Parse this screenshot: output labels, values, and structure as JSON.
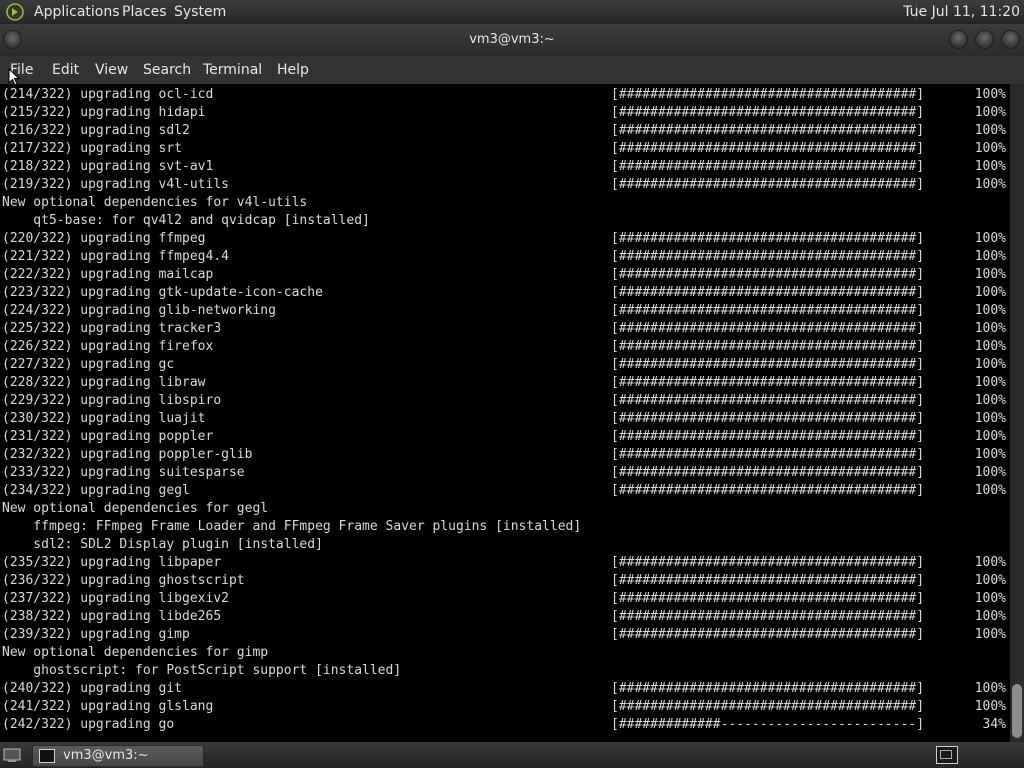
{
  "top_panel": {
    "menus": [
      "Applications",
      "Places",
      "System"
    ],
    "clock": "Tue Jul 11, 11:20"
  },
  "window": {
    "title": "vm3@vm3:~"
  },
  "menubar": {
    "items": [
      "File",
      "Edit",
      "View",
      "Search",
      "Terminal",
      "Help"
    ]
  },
  "terminal": {
    "lines": [
      {
        "text": "(214/322) upgrading ocl-icd",
        "bar": "[######################################]",
        "pct": "100%"
      },
      {
        "text": "(215/322) upgrading hidapi",
        "bar": "[######################################]",
        "pct": "100%"
      },
      {
        "text": "(216/322) upgrading sdl2",
        "bar": "[######################################]",
        "pct": "100%"
      },
      {
        "text": "(217/322) upgrading srt",
        "bar": "[######################################]",
        "pct": "100%"
      },
      {
        "text": "(218/322) upgrading svt-av1",
        "bar": "[######################################]",
        "pct": "100%"
      },
      {
        "text": "(219/322) upgrading v4l-utils",
        "bar": "[######################################]",
        "pct": "100%"
      },
      {
        "text": "New optional dependencies for v4l-utils"
      },
      {
        "text": "    qt5-base: for qv4l2 and qvidcap [installed]"
      },
      {
        "text": "(220/322) upgrading ffmpeg",
        "bar": "[######################################]",
        "pct": "100%"
      },
      {
        "text": "(221/322) upgrading ffmpeg4.4",
        "bar": "[######################################]",
        "pct": "100%"
      },
      {
        "text": "(222/322) upgrading mailcap",
        "bar": "[######################################]",
        "pct": "100%"
      },
      {
        "text": "(223/322) upgrading gtk-update-icon-cache",
        "bar": "[######################################]",
        "pct": "100%"
      },
      {
        "text": "(224/322) upgrading glib-networking",
        "bar": "[######################################]",
        "pct": "100%"
      },
      {
        "text": "(225/322) upgrading tracker3",
        "bar": "[######################################]",
        "pct": "100%"
      },
      {
        "text": "(226/322) upgrading firefox",
        "bar": "[######################################]",
        "pct": "100%"
      },
      {
        "text": "(227/322) upgrading gc",
        "bar": "[######################################]",
        "pct": "100%"
      },
      {
        "text": "(228/322) upgrading libraw",
        "bar": "[######################################]",
        "pct": "100%"
      },
      {
        "text": "(229/322) upgrading libspiro",
        "bar": "[######################################]",
        "pct": "100%"
      },
      {
        "text": "(230/322) upgrading luajit",
        "bar": "[######################################]",
        "pct": "100%"
      },
      {
        "text": "(231/322) upgrading poppler",
        "bar": "[######################################]",
        "pct": "100%"
      },
      {
        "text": "(232/322) upgrading poppler-glib",
        "bar": "[######################################]",
        "pct": "100%"
      },
      {
        "text": "(233/322) upgrading suitesparse",
        "bar": "[######################################]",
        "pct": "100%"
      },
      {
        "text": "(234/322) upgrading gegl",
        "bar": "[######################################]",
        "pct": "100%"
      },
      {
        "text": "New optional dependencies for gegl"
      },
      {
        "text": "    ffmpeg: FFmpeg Frame Loader and FFmpeg Frame Saver plugins [installed]"
      },
      {
        "text": "    sdl2: SDL2 Display plugin [installed]"
      },
      {
        "text": "(235/322) upgrading libpaper",
        "bar": "[######################################]",
        "pct": "100%"
      },
      {
        "text": "(236/322) upgrading ghostscript",
        "bar": "[######################################]",
        "pct": "100%"
      },
      {
        "text": "(237/322) upgrading libgexiv2",
        "bar": "[######################################]",
        "pct": "100%"
      },
      {
        "text": "(238/322) upgrading libde265",
        "bar": "[######################################]",
        "pct": "100%"
      },
      {
        "text": "(239/322) upgrading gimp",
        "bar": "[######################################]",
        "pct": "100%"
      },
      {
        "text": "New optional dependencies for gimp"
      },
      {
        "text": "    ghostscript: for PostScript support [installed]"
      },
      {
        "text": "(240/322) upgrading git",
        "bar": "[######################################]",
        "pct": "100%"
      },
      {
        "text": "(241/322) upgrading glslang",
        "bar": "[######################################]",
        "pct": "100%"
      },
      {
        "text": "(242/322) upgrading go",
        "bar": "[#############-------------------------]",
        "pct": "34%"
      }
    ]
  },
  "taskbar": {
    "task_label": "vm3@vm3:~"
  },
  "colors": {
    "terminal_bg": "#000000",
    "terminal_fg": "#d9d9d9",
    "panel_bg": "#2e2e2e"
  },
  "icons": {
    "top_logo": "gnome-foot-icon",
    "task": "terminal-icon",
    "workspace": "workspace-switcher-icon",
    "cursor": "mouse-pointer-icon"
  }
}
